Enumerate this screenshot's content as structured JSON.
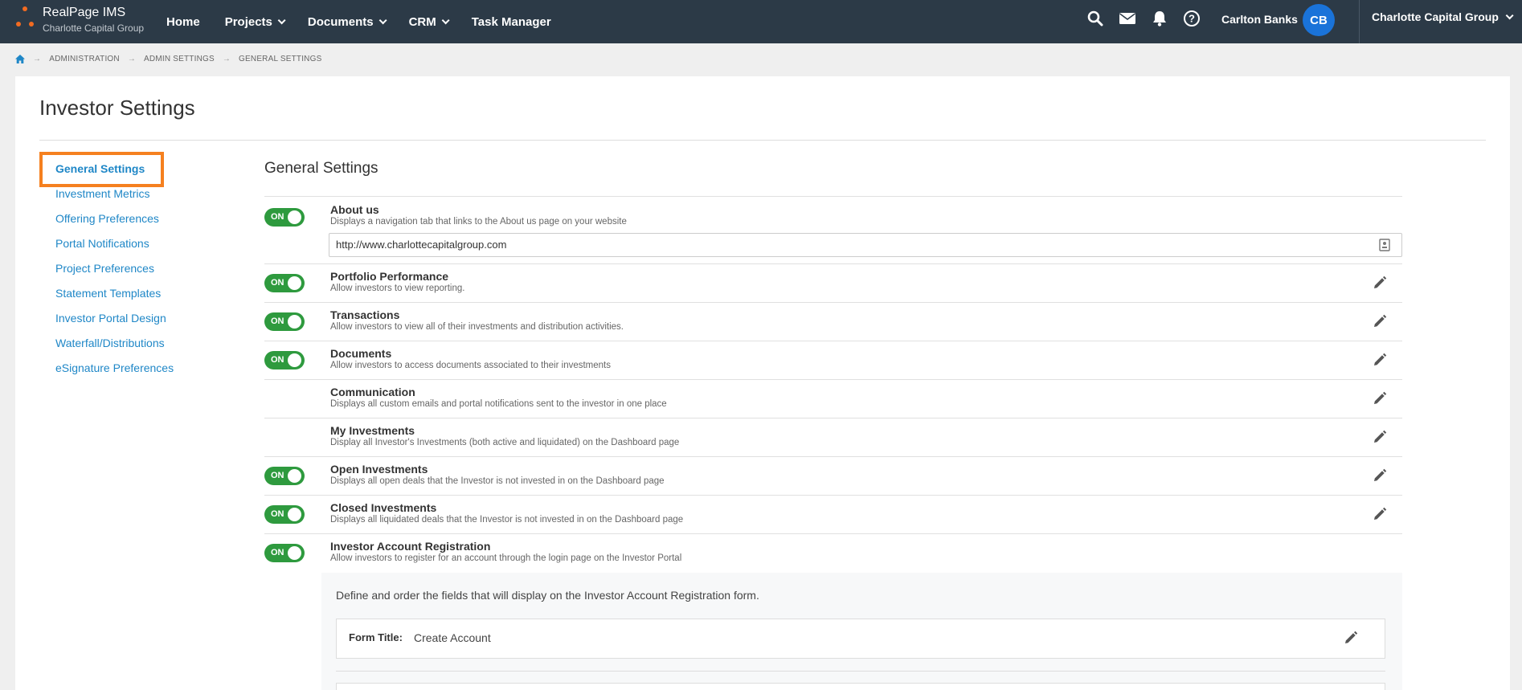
{
  "app": {
    "name": "RealPage IMS",
    "org": "Charlotte Capital Group"
  },
  "nav": {
    "items": [
      {
        "label": "Home"
      },
      {
        "label": "Projects"
      },
      {
        "label": "Documents"
      },
      {
        "label": "CRM"
      },
      {
        "label": "Task Manager"
      }
    ]
  },
  "user": {
    "name": "Carlton Banks",
    "initials": "CB",
    "org_switch": "Charlotte Capital Group"
  },
  "breadcrumb": [
    "ADMINISTRATION",
    "ADMIN SETTINGS",
    "GENERAL SETTINGS"
  ],
  "page": {
    "title": "Investor Settings"
  },
  "sidebar": {
    "items": [
      {
        "label": "General Settings"
      },
      {
        "label": "Investment Metrics"
      },
      {
        "label": "Offering Preferences"
      },
      {
        "label": "Portal Notifications"
      },
      {
        "label": "Project Preferences"
      },
      {
        "label": "Statement Templates"
      },
      {
        "label": "Investor Portal Design"
      },
      {
        "label": "Waterfall/Distributions"
      },
      {
        "label": "eSignature Preferences"
      }
    ]
  },
  "main": {
    "section_title": "General Settings",
    "toggle_label": "ON",
    "about_url": "http://www.charlottecapitalgroup.com",
    "settings": [
      {
        "title": "About us",
        "desc": "Displays a navigation tab that links to the About us page on your website"
      },
      {
        "title": "Portfolio Performance",
        "desc": "Allow investors to view reporting."
      },
      {
        "title": "Transactions",
        "desc": "Allow investors to view all of their investments and distribution activities."
      },
      {
        "title": "Documents",
        "desc": "Allow investors to access documents associated to their investments"
      },
      {
        "title": "Communication",
        "desc": "Displays all custom emails and portal notifications sent to the investor in one place"
      },
      {
        "title": "My Investments",
        "desc": "Display all Investor's Investments (both active and liquidated) on the Dashboard page"
      },
      {
        "title": "Open Investments",
        "desc": "Displays all open deals that the Investor is not invested in on the Dashboard page"
      },
      {
        "title": "Closed Investments",
        "desc": "Displays all liquidated deals that the Investor is not invested in on the Dashboard page"
      },
      {
        "title": "Investor Account Registration",
        "desc": "Allow investors to register for an account through the login page on the Investor Portal"
      }
    ],
    "registration": {
      "intro": "Define and order the fields that will display on the Investor Account Registration form.",
      "form_title_label": "Form Title:",
      "form_title_value": "Create Account"
    }
  },
  "colors": {
    "topbar": "#2c3a47",
    "accent_link": "#1f87c7",
    "toggle_on": "#2e9a3e",
    "highlight": "#f5801f",
    "avatar": "#1a73d9"
  }
}
